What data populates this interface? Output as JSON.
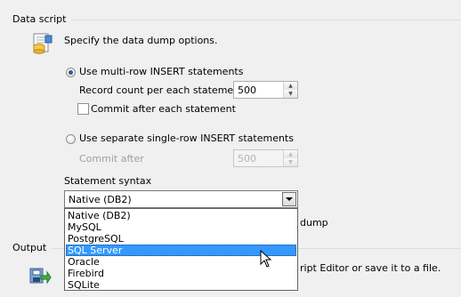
{
  "data_script": {
    "group_title": "Data script",
    "description": "Specify the data dump options.",
    "multi_row_label": "Use multi-row INSERT statements",
    "record_count_label": "Record count per each statement",
    "record_count_value": "500",
    "commit_each_label": "Commit after each statement",
    "single_row_label": "Use separate single-row INSERT statements",
    "commit_after_label": "Commit after",
    "commit_after_value": "500",
    "statement_syntax_label": "Statement syntax",
    "statement_syntax_value": "Native (DB2)",
    "hidden_option_tail": "dump"
  },
  "syntax_dropdown": {
    "options": [
      "Native (DB2)",
      "MySQL",
      "PostgreSQL",
      "SQL Server",
      "Oracle",
      "Firebird",
      "SQLite"
    ],
    "highlighted": "SQL Server"
  },
  "output": {
    "group_title": "Output",
    "description_tail": "ript Editor or save it to a file."
  },
  "colors": {
    "highlight": "#3399ff",
    "background": "#f0f0f0"
  },
  "icons": [
    "data-script-icon",
    "output-export-icon",
    "mouse-cursor-icon"
  ]
}
